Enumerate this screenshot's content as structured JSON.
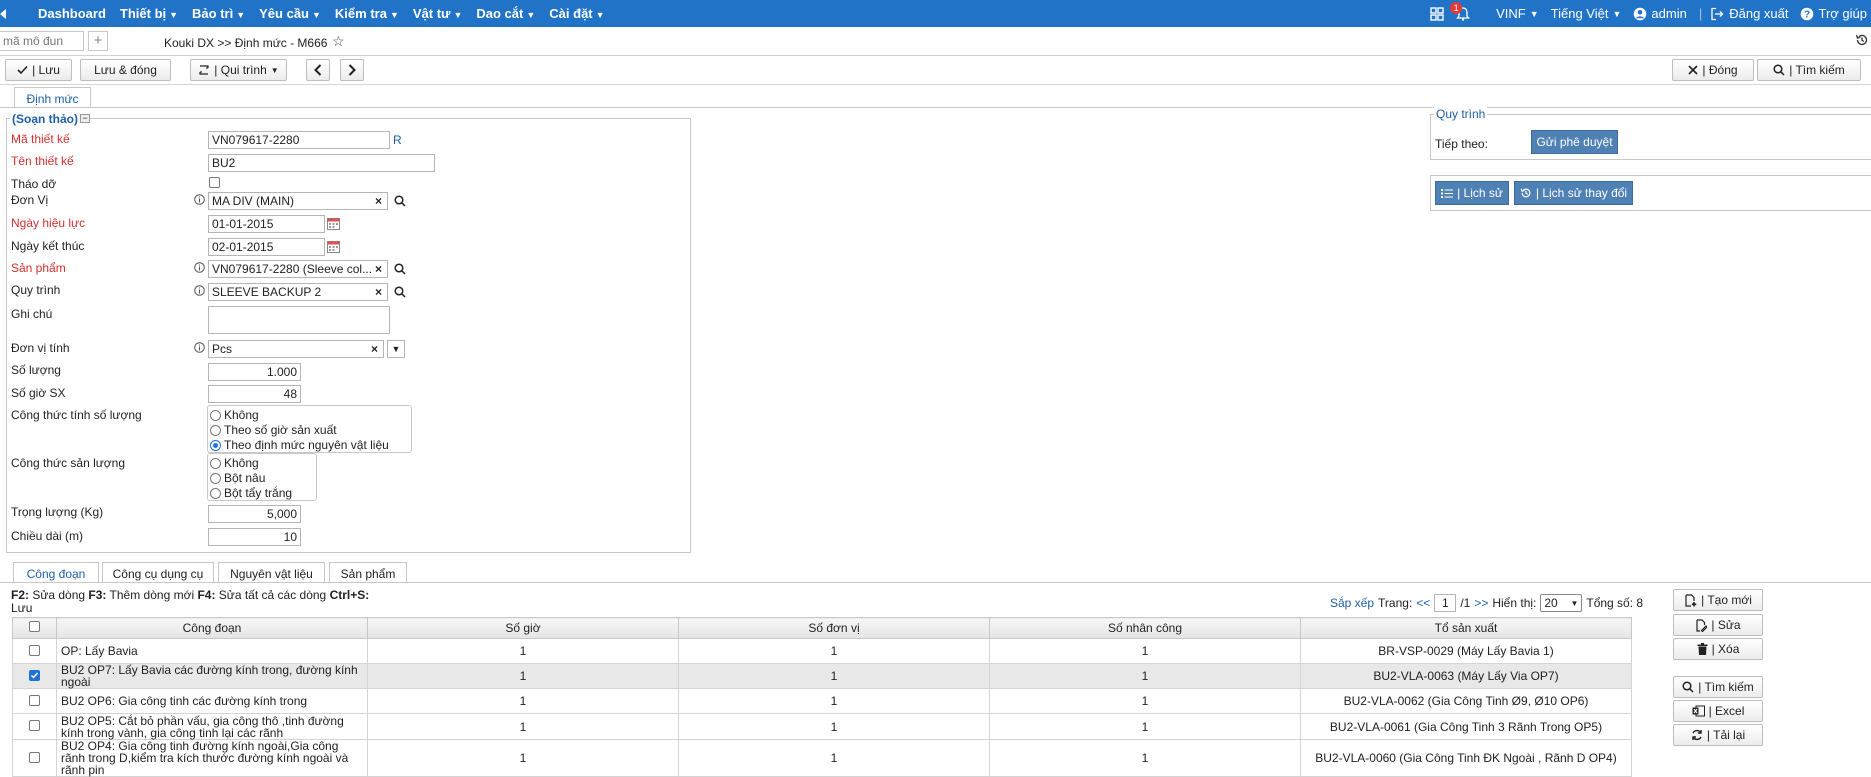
{
  "nav": {
    "items": [
      "Dashboard",
      "Thiết bị",
      "Bảo trì",
      "Yêu cầu",
      "Kiểm tra",
      "Vật tư",
      "Dao cắt",
      "Cài đặt"
    ],
    "notif_count": "1",
    "org": "VINF",
    "language": "Tiếng Việt",
    "user": "admin",
    "logout": "Đăng xuất",
    "help": "Trợ giúp"
  },
  "tabstrip": {
    "module_placeholder": "mã mô đun",
    "breadcrumb": "Kouki DX >> Định mức - M666"
  },
  "toolbar": {
    "save": "| Lưu",
    "save_close": "Lưu & đóng",
    "workflow": "| Qui trình",
    "close": "| Đóng",
    "search": "| Tìm kiếm"
  },
  "main_tab": "Định mức",
  "form": {
    "status_legend": "(Soạn thảo)",
    "ma_thiet_ke": {
      "label": "Mã thiết kế",
      "value": "VN079617-2280",
      "suffix": "R"
    },
    "ten_thiet_ke": {
      "label": "Tên thiết kế",
      "value": "BU2"
    },
    "thao_do": {
      "label": "Tháo dỡ"
    },
    "don_vi": {
      "label": "Đơn Vị",
      "value": "MA DIV (MAIN)"
    },
    "ngay_hieu_luc": {
      "label": "Ngày hiệu lực",
      "value": "01-01-2015"
    },
    "ngay_ket_thuc": {
      "label": "Ngày kết thúc",
      "value": "02-01-2015"
    },
    "san_pham": {
      "label": "Sản phẩm",
      "value": "VN079617-2280 (Sleeve col..."
    },
    "quy_trinh": {
      "label": "Quy trình",
      "value": "SLEEVE BACKUP 2"
    },
    "ghi_chu": {
      "label": "Ghi chú",
      "value": ""
    },
    "don_vi_tinh": {
      "label": "Đơn vị tính",
      "value": "Pcs"
    },
    "so_luong": {
      "label": "Số lượng",
      "value": "1.000"
    },
    "so_gio_sx": {
      "label": "Số giờ SX",
      "value": "48"
    },
    "cong_thuc_so_luong": {
      "label": "Công thức tính số lượng",
      "options": [
        "Không",
        "Theo số giờ sản xuất",
        "Theo định mức nguyên vật liệu"
      ],
      "selected": 2
    },
    "cong_thuc_san_luong": {
      "label": "Công thức sản lượng",
      "options": [
        "Không",
        "Bột nâu",
        "Bột tẩy trắng"
      ],
      "selected": -1
    },
    "trong_luong": {
      "label": "Trọng lượng (Kg)",
      "value": "5,000"
    },
    "chieu_dai": {
      "label": "Chiều dài (m)",
      "value": "10"
    }
  },
  "workflow_panel": {
    "legend": "Quy trình",
    "next_label": "Tiếp theo:",
    "submit_button": "Gửi phê duyệt",
    "history_button": "| Lịch sử",
    "change_history_button": "| Lịch sử thay đổi"
  },
  "detail_tabs": [
    "Công đoạn",
    "Công cụ dụng cụ",
    "Nguyên vật liệu",
    "Sản phẩm"
  ],
  "shortcuts": {
    "f2": "F2:",
    "f2_text": " Sửa dòng ",
    "f3": "F3:",
    "f3_text": " Thêm dòng mới ",
    "f4": "F4:",
    "f4_text": " Sửa tất cả các dòng ",
    "ctrl": "Ctrl+S:",
    "ctrl_text": "Lưu"
  },
  "pager": {
    "sort": "Sắp xếp",
    "page_label": "Trang:",
    "prev": "<<",
    "page": "1",
    "of": "/1",
    "next": ">>",
    "show_label": "Hiển thị:",
    "page_size": "20",
    "total": "Tổng số: 8"
  },
  "grid": {
    "columns": [
      "Công đoạn",
      "Số giờ",
      "Số đơn vị",
      "Số nhân công",
      "Tổ sản xuất"
    ],
    "rows": [
      {
        "checked": false,
        "cong_doan": "OP: Lấy Bavia",
        "so_gio": "1",
        "so_don_vi": "1",
        "so_nhan_cong": "1",
        "to_san_xuat": "BR-VSP-0029 (Máy Lấy Bavia 1)"
      },
      {
        "checked": true,
        "cong_doan": "BU2 OP7: Lấy Bavia các đường kính trong, đường kính ngoài",
        "so_gio": "1",
        "so_don_vi": "1",
        "so_nhan_cong": "1",
        "to_san_xuat": "BU2-VLA-0063 (Máy Lấy Via OP7)"
      },
      {
        "checked": false,
        "cong_doan": "BU2 OP6: Gia công tinh các đường kính trong",
        "so_gio": "1",
        "so_don_vi": "1",
        "so_nhan_cong": "1",
        "to_san_xuat": "BU2-VLA-0062 (Gia Công Tinh Ø9, Ø10 OP6)"
      },
      {
        "checked": false,
        "cong_doan": "BU2 OP5: Cắt bỏ phần vấu, gia công thô ,tinh đường kính trong vành, gia công tinh lại các rãnh",
        "so_gio": "1",
        "so_don_vi": "1",
        "so_nhan_cong": "1",
        "to_san_xuat": "BU2-VLA-0061 (Gia Công Tinh 3 Rãnh Trong OP5)"
      },
      {
        "checked": false,
        "cong_doan": "BU2 OP4: Gia công tinh đường kính ngoài,Gia công rãnh trong D,kiểm tra kích thước đường kính ngoài và rãnh pin",
        "so_gio": "1",
        "so_don_vi": "1",
        "so_nhan_cong": "1",
        "to_san_xuat": "BU2-VLA-0060 (Gia Công Tinh ĐK Ngoài , Rãnh D OP4)"
      }
    ]
  },
  "side_actions": {
    "create": "| Tạo mới",
    "edit": "| Sửa",
    "delete": "| Xóa",
    "search": "| Tìm kiếm",
    "excel": "| Excel",
    "reload": "| Tải lại"
  },
  "colors": {
    "nav_bg": "#2073c7",
    "required_label": "#d32f2f",
    "link_blue": "#1f5fa6",
    "action_button": "#4f81b5"
  }
}
